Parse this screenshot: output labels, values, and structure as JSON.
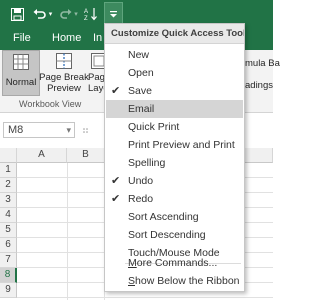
{
  "colors": {
    "ribbon_green": "#217346",
    "selected_row": "#217346"
  },
  "quick_access": {
    "save_icon": "save-icon",
    "undo_icon": "undo-icon",
    "redo_icon": "redo-icon",
    "sort_icon": "sort-icon",
    "customize_icon": "customize-dropdown-icon"
  },
  "tabs": {
    "file": "File",
    "home": "Home",
    "insert_partial": "In"
  },
  "ribbon": {
    "normal": "Normal",
    "page_break_line1": "Page Break",
    "page_break_line2": "Preview",
    "page_layout_line1": "Pag",
    "page_layout_line2": "Layo",
    "formula_bar_partial": "mula Ba",
    "headings_partial": "adings",
    "group_label": "Workbook View"
  },
  "formula_bar": {
    "name_box": "M8"
  },
  "grid": {
    "columns": [
      "A",
      "B"
    ],
    "rows": [
      "1",
      "2",
      "3",
      "4",
      "5",
      "6",
      "7",
      "8",
      "9"
    ],
    "selected_row": "8"
  },
  "menu": {
    "title": "Customize Quick Access Toolbar",
    "items": [
      {
        "label": "New",
        "checked": false
      },
      {
        "label": "Open",
        "checked": false
      },
      {
        "label": "Save",
        "checked": true
      },
      {
        "label": "Email",
        "checked": false,
        "highlighted": true
      },
      {
        "label": "Quick Print",
        "checked": false
      },
      {
        "label": "Print Preview and Print",
        "checked": false
      },
      {
        "label": "Spelling",
        "checked": false
      },
      {
        "label": "Undo",
        "checked": true
      },
      {
        "label": "Redo",
        "checked": true
      },
      {
        "label": "Sort Ascending",
        "checked": false
      },
      {
        "label": "Sort Descending",
        "checked": false
      },
      {
        "label": "Touch/Mouse Mode",
        "checked": false
      }
    ],
    "more_commands_prefix": "M",
    "more_commands_rest": "ore Commands...",
    "show_below_prefix": "S",
    "show_below_rest": "how Below the Ribbon",
    "check_glyph": "✔"
  }
}
